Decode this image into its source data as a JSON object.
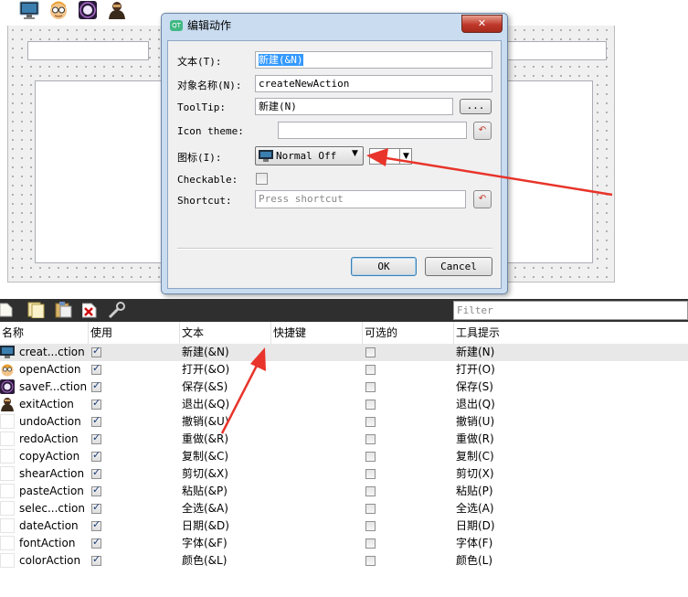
{
  "dialog": {
    "title": "编辑动作",
    "labels": {
      "text": "文本(T):",
      "object_name": "对象名称(N):",
      "tooltip": "ToolTip:",
      "icon_theme": "Icon theme:",
      "icon": "图标(I):",
      "checkable": "Checkable:",
      "shortcut": "Shortcut:"
    },
    "values": {
      "text": "新建(&N)",
      "object_name": "createNewAction",
      "tooltip": "新建(N)",
      "icon_theme": "",
      "icon_select": "Normal Off",
      "shortcut_placeholder": "Press shortcut",
      "checkable": false
    },
    "buttons": {
      "browse": "...",
      "ok": "OK",
      "cancel": "Cancel",
      "close": "✕"
    }
  },
  "action_editor": {
    "filter_placeholder": "Filter",
    "columns": [
      "名称",
      "使用",
      "文本",
      "快捷键",
      "可选的",
      "工具提示"
    ],
    "rows": [
      {
        "name": "creat...ction",
        "used": true,
        "text": "新建(&N)",
        "shortcut": "",
        "checkable": false,
        "tooltip": "新建(N)",
        "icon": "monitor-icon"
      },
      {
        "name": "openAction",
        "used": true,
        "text": "打开(&O)",
        "shortcut": "",
        "checkable": false,
        "tooltip": "打开(O)",
        "icon": "face-icon"
      },
      {
        "name": "saveF...ction",
        "used": true,
        "text": "保存(&S)",
        "shortcut": "",
        "checkable": false,
        "tooltip": "保存(S)",
        "icon": "space-icon"
      },
      {
        "name": "exitAction",
        "used": true,
        "text": "退出(&Q)",
        "shortcut": "",
        "checkable": false,
        "tooltip": "退出(Q)",
        "icon": "character-icon"
      },
      {
        "name": "undoAction",
        "used": true,
        "text": "撤销(&U)",
        "shortcut": "",
        "checkable": false,
        "tooltip": "撤销(U)",
        "icon": ""
      },
      {
        "name": "redoAction",
        "used": true,
        "text": "重做(&R)",
        "shortcut": "",
        "checkable": false,
        "tooltip": "重做(R)",
        "icon": ""
      },
      {
        "name": "copyAction",
        "used": true,
        "text": "复制(&C)",
        "shortcut": "",
        "checkable": false,
        "tooltip": "复制(C)",
        "icon": ""
      },
      {
        "name": "shearAction",
        "used": true,
        "text": "剪切(&X)",
        "shortcut": "",
        "checkable": false,
        "tooltip": "剪切(X)",
        "icon": ""
      },
      {
        "name": "pasteAction",
        "used": true,
        "text": "粘贴(&P)",
        "shortcut": "",
        "checkable": false,
        "tooltip": "粘贴(P)",
        "icon": ""
      },
      {
        "name": "selec...ction",
        "used": true,
        "text": "全选(&A)",
        "shortcut": "",
        "checkable": false,
        "tooltip": "全选(A)",
        "icon": ""
      },
      {
        "name": "dateAction",
        "used": true,
        "text": "日期(&D)",
        "shortcut": "",
        "checkable": false,
        "tooltip": "日期(D)",
        "icon": ""
      },
      {
        "name": "fontAction",
        "used": true,
        "text": "字体(&F)",
        "shortcut": "",
        "checkable": false,
        "tooltip": "字体(F)",
        "icon": ""
      },
      {
        "name": "colorAction",
        "used": true,
        "text": "颜色(&L)",
        "shortcut": "",
        "checkable": false,
        "tooltip": "颜色(L)",
        "icon": ""
      }
    ]
  },
  "colors": {
    "annotation_arrow": "#e8342a",
    "selection": "#3399ff",
    "check_mark": "#1b3a78"
  }
}
